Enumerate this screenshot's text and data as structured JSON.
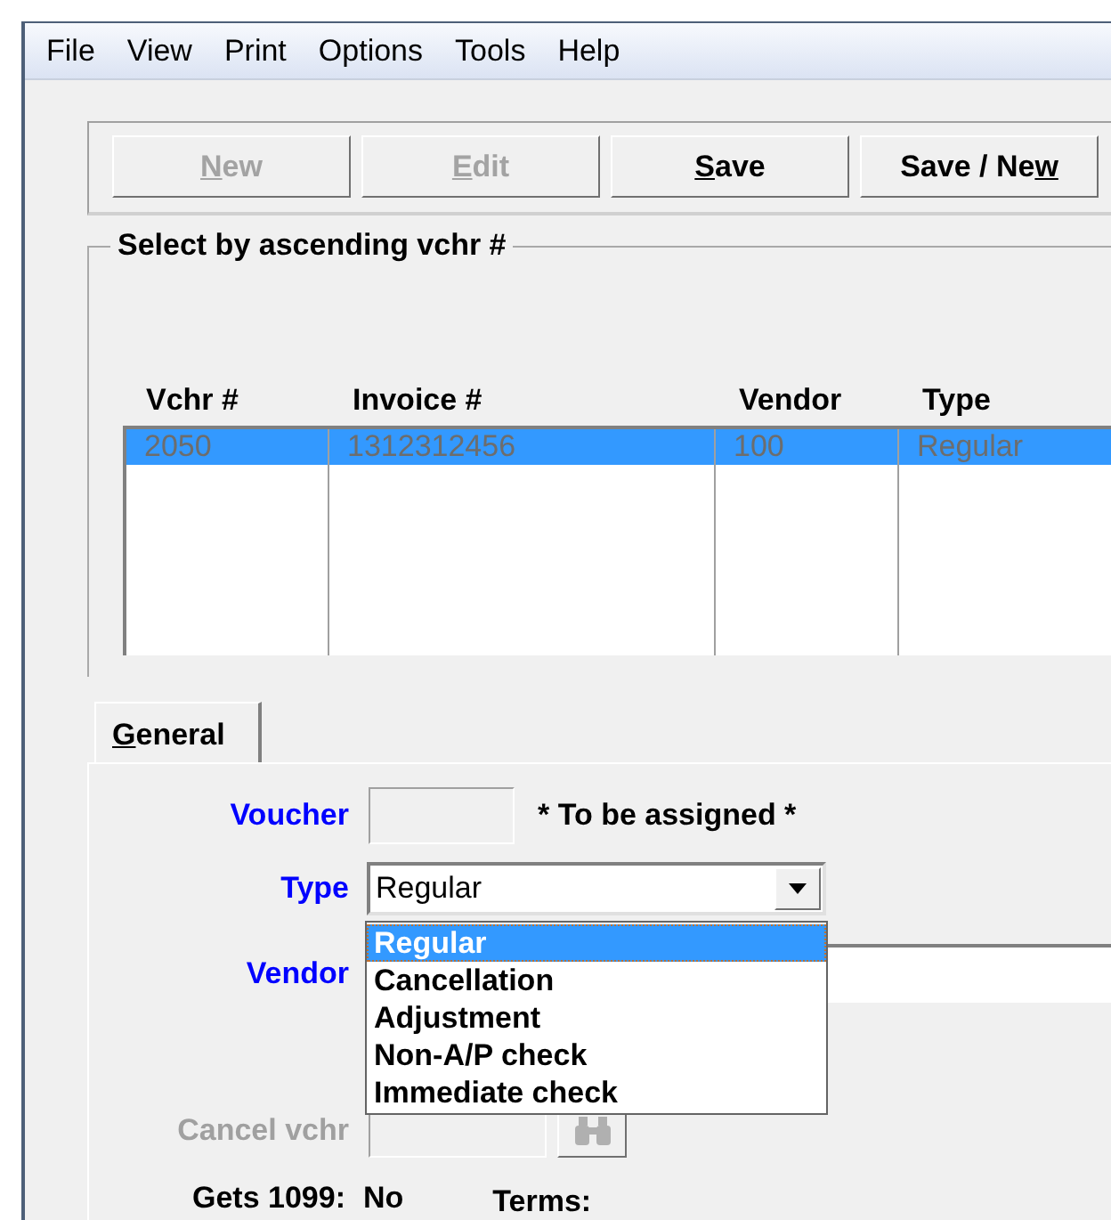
{
  "menu": [
    "File",
    "View",
    "Print",
    "Options",
    "Tools",
    "Help"
  ],
  "toolbar": {
    "buttons": [
      {
        "access_key": "N",
        "label_after": "ew",
        "disabled": true
      },
      {
        "access_key": "E",
        "label_after": "dit",
        "disabled": true
      },
      {
        "access_key": "S",
        "label_after": "ave",
        "disabled": false
      },
      {
        "label_before": "Save / Ne",
        "access_key": "w",
        "disabled": false
      }
    ]
  },
  "selection_group": {
    "title": "Select by ascending vchr #",
    "columns": [
      "Vchr #",
      "Invoice #",
      "Vendor",
      "Type"
    ],
    "rows": [
      {
        "cells": [
          "2050",
          "1312312456",
          "100",
          "Regular"
        ],
        "selected": true
      }
    ]
  },
  "tabs": [
    {
      "access_key": "G",
      "label_after": "eneral",
      "selected": true
    }
  ],
  "form": {
    "voucher": {
      "label": "Voucher",
      "note": "* To be assigned *",
      "disabled": true
    },
    "type": {
      "label": "Type",
      "value": "Regular",
      "open": true,
      "options": [
        {
          "label": "Regular",
          "selected": true
        },
        {
          "label": "Cancellation",
          "selected": false
        },
        {
          "label": "Adjustment",
          "selected": false
        },
        {
          "label": "Non-A/P check",
          "selected": false
        },
        {
          "label": "Immediate check",
          "selected": false
        }
      ]
    },
    "vendor": {
      "label": "Vendor"
    },
    "cancel_voucher": {
      "label": "Cancel vchr",
      "disabled": true
    },
    "gets_1099": {
      "label": "Gets 1099:",
      "value": "No"
    },
    "terms": {
      "label": "Terms:"
    }
  }
}
